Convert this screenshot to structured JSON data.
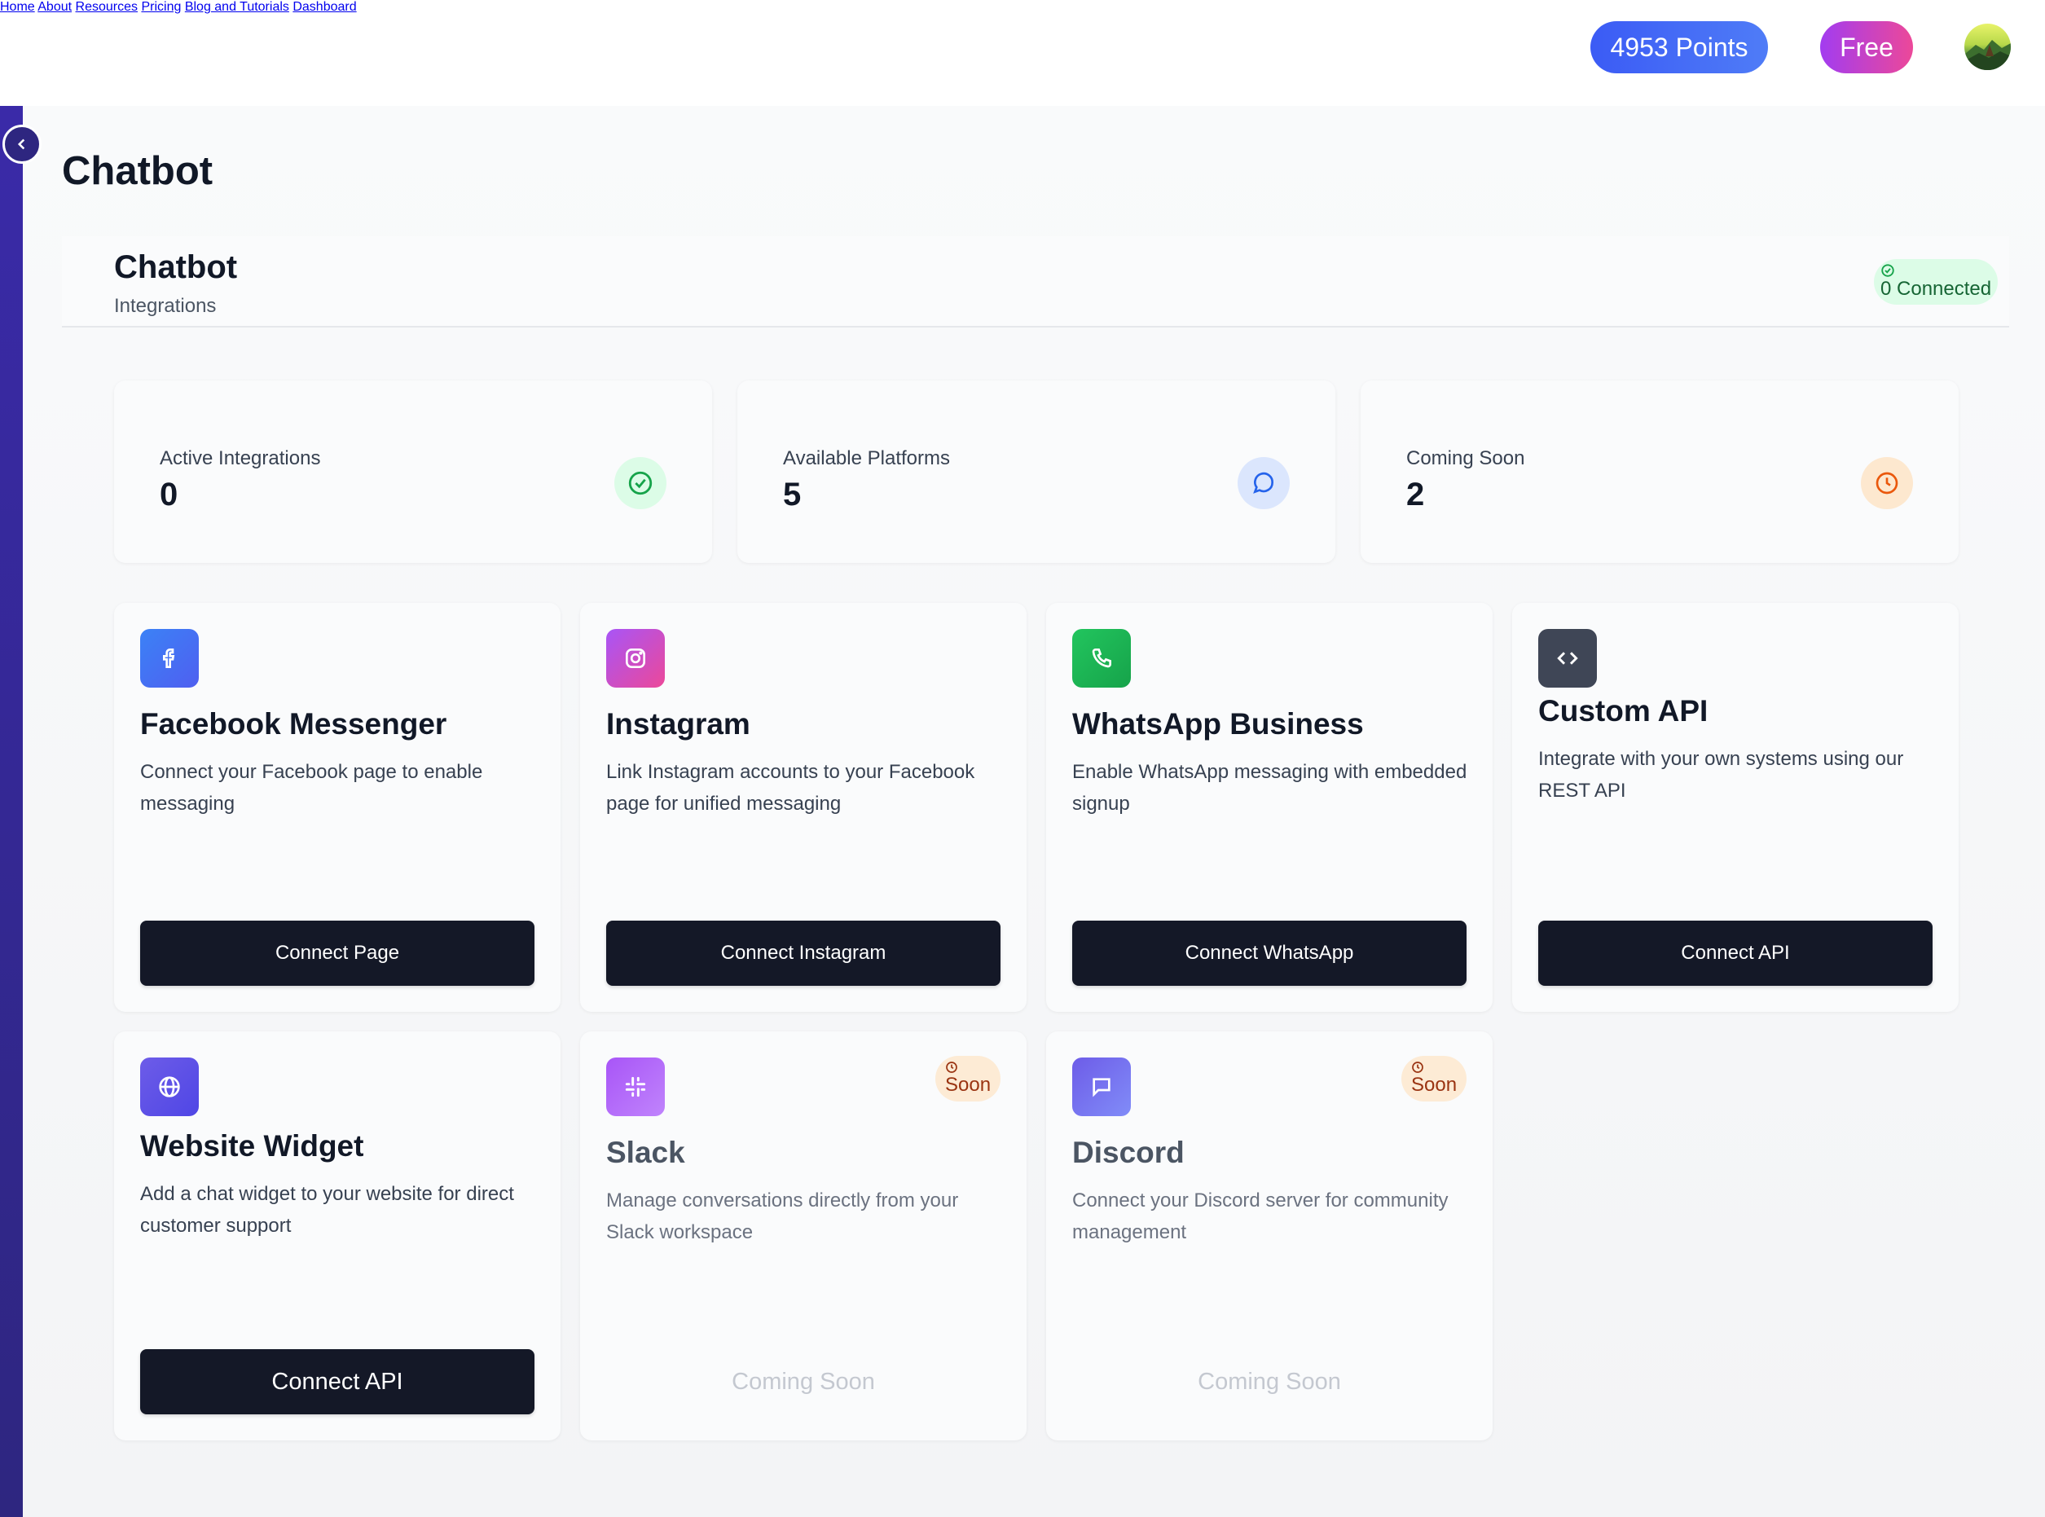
{
  "nav": {
    "links": [
      "Home",
      "About",
      "Resources",
      "Pricing",
      "Blog and Tutorials",
      "Dashboard"
    ],
    "points_label": "4953 Points",
    "plan_label": "Free",
    "colors": {
      "points": "#3b5bf5",
      "plan": "#a23cf0"
    }
  },
  "page": {
    "title": "Chatbot"
  },
  "panel": {
    "title": "Chatbot",
    "subtitle": "Integrations",
    "connected_badge": "0 Connected"
  },
  "stats": [
    {
      "label": "Active Integrations",
      "value": "0",
      "icon": "check-circle-icon",
      "color": "#16a34a"
    },
    {
      "label": "Available Platforms",
      "value": "5",
      "icon": "message-circle-icon",
      "color": "#2563eb"
    },
    {
      "label": "Coming Soon",
      "value": "2",
      "icon": "clock-icon",
      "color": "#ea580c"
    }
  ],
  "integrations": [
    {
      "title": "Facebook Messenger",
      "description": "Connect your Facebook page to enable messaging",
      "action": "Connect Page",
      "icon": "facebook-icon",
      "color": "#3b6cf6"
    },
    {
      "title": "Instagram",
      "description": "Link Instagram accounts to your Facebook page for unified messaging",
      "action": "Connect Instagram",
      "icon": "instagram-icon",
      "color": "#d63fa0"
    },
    {
      "title": "WhatsApp Business",
      "description": "Enable WhatsApp messaging with embedded signup",
      "action": "Connect WhatsApp",
      "icon": "phone-icon",
      "color": "#22b04b"
    },
    {
      "title": "Custom API",
      "description": "Integrate with your own systems using our REST API",
      "action": "Connect API",
      "icon": "code-icon",
      "color": "#3f4656"
    },
    {
      "title": "Website Widget",
      "description": "Add a chat widget to your website for direct customer support",
      "action": "Connect API",
      "icon": "globe-icon",
      "color": "#5b4ff0"
    },
    {
      "title": "Slack",
      "description": "Manage conversations directly from your Slack workspace",
      "action": "Coming Soon",
      "badge": "Soon",
      "icon": "slack-icon",
      "color": "#a855f7"
    },
    {
      "title": "Discord",
      "description": "Connect your Discord server for community management",
      "action": "Coming Soon",
      "badge": "Soon",
      "icon": "message-square-icon",
      "color": "#6d5ce8"
    }
  ]
}
